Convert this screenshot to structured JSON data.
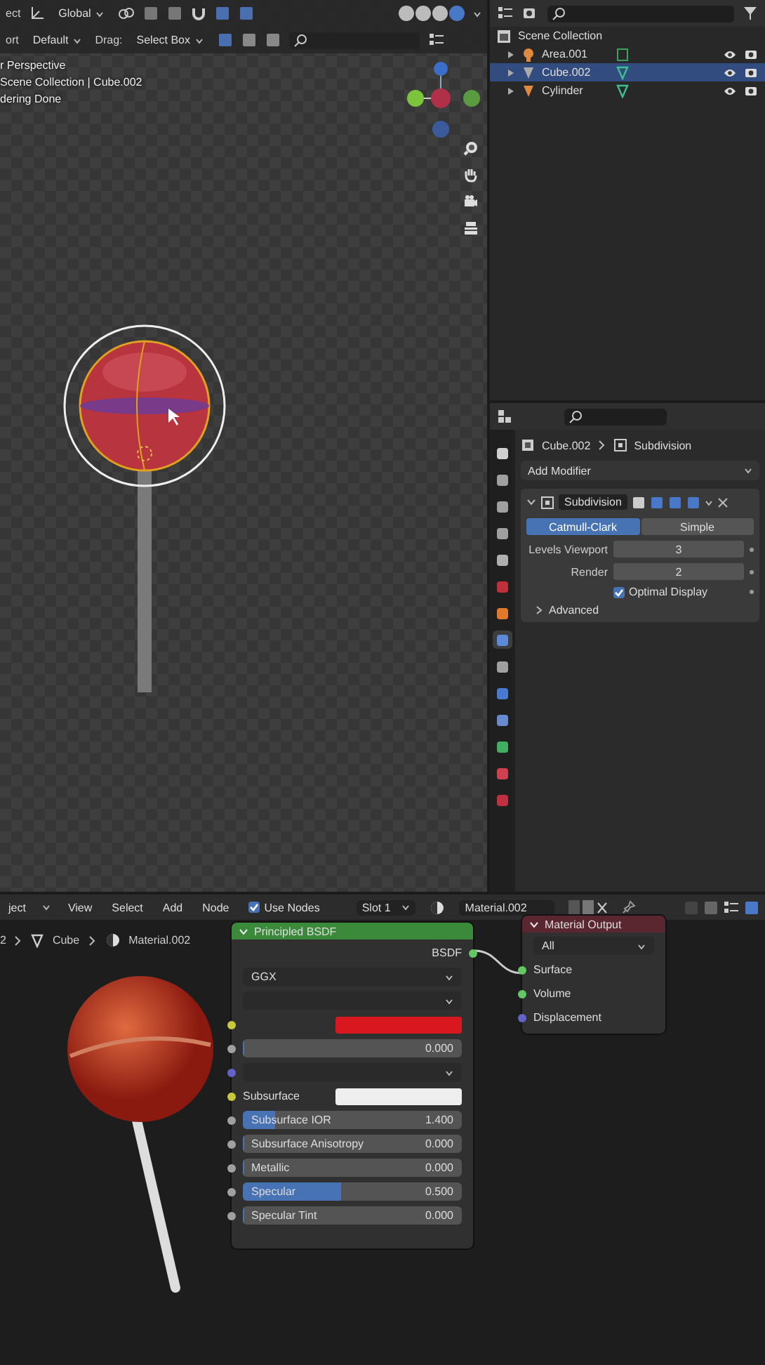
{
  "viewport": {
    "toolbar_top": [
      {
        "kind": "label",
        "label": "ect"
      },
      {
        "kind": "dropdown",
        "label": "Global"
      }
    ],
    "shading_modes": [
      {
        "selected": false
      },
      {
        "selected": false
      },
      {
        "selected": false
      },
      {
        "selected": true
      }
    ],
    "toolbar_bottom": [
      {
        "kind": "label",
        "label": "ort"
      },
      {
        "kind": "dropdown",
        "label": "Default"
      },
      {
        "kind": "label",
        "label": "Drag:"
      },
      {
        "kind": "dropdown",
        "label": "Select Box"
      }
    ],
    "info": [
      "r Perspective",
      "Scene Collection | Cube.002",
      "dering Done"
    ]
  },
  "outliner": {
    "root": "Scene Collection",
    "items": [
      {
        "name": "Area.001",
        "kind": "light",
        "selected": false
      },
      {
        "name": "Cube.002",
        "kind": "mesh",
        "selected": true
      },
      {
        "name": "Cylinder",
        "kind": "mesh",
        "selected": false
      }
    ]
  },
  "properties": {
    "tabs": [
      {
        "color": "#d0d0d0",
        "selected": false
      },
      {
        "color": "#a0a0a0",
        "selected": false
      },
      {
        "color": "#a0a0a0",
        "selected": false
      },
      {
        "color": "#a0a0a0",
        "selected": false
      },
      {
        "color": "#b0b0b0",
        "selected": false
      },
      {
        "color": "#c0303a",
        "selected": false
      },
      {
        "color": "#e07a2a",
        "selected": false
      },
      {
        "color": "#5a8ad8",
        "selected": true
      },
      {
        "color": "#a0a0a0",
        "selected": false
      },
      {
        "color": "#4a7ad0",
        "selected": false
      },
      {
        "color": "#6a8ad0",
        "selected": false
      },
      {
        "color": "#40b060",
        "selected": false
      },
      {
        "color": "#d04050",
        "selected": false
      },
      {
        "color": "#c03040",
        "selected": false
      }
    ],
    "breadcrumb": [
      "Cube.002",
      "Subdivision"
    ],
    "add_modifier": "Add Modifier",
    "modifier": {
      "name": "Subdivision",
      "expanded": true,
      "tabs": [
        {
          "label": "Catmull-Clark",
          "selected": true
        },
        {
          "label": "Simple",
          "selected": false
        }
      ],
      "fields": [
        {
          "label": "Levels Viewport",
          "value": "3"
        },
        {
          "label": "Render",
          "value": "2"
        }
      ],
      "optimal_display": {
        "label": "Optimal Display",
        "checked": true
      },
      "advanced": {
        "label": "Advanced",
        "expanded": false
      }
    }
  },
  "node_editor": {
    "menus": [
      "ject",
      "View",
      "Select",
      "Add",
      "Node"
    ],
    "use_nodes": {
      "label": "Use Nodes",
      "checked": true
    },
    "slot": "Slot 1",
    "material": "Material.002",
    "breadcrumb": [
      "2",
      "Cube",
      "Material.002"
    ],
    "principled": {
      "title": "Principled BSDF",
      "output": "BSDF",
      "rows": [
        {
          "kind": "dropdown",
          "label": "GGX"
        },
        {
          "kind": "dropdown"
        },
        {
          "kind": "color",
          "color": "#d8181e"
        },
        {
          "kind": "value",
          "value": "0.000",
          "level": 0
        },
        {
          "kind": "dropdown",
          "socket": true
        },
        {
          "kind": "color",
          "label": "Subsurface",
          "color": "#eeeeee"
        },
        {
          "kind": "value",
          "label": "Subsurface IOR",
          "value": "1.400",
          "level": 0.15
        },
        {
          "kind": "value",
          "label": "Subsurface Anisotropy",
          "value": "0.000",
          "level": 0
        },
        {
          "kind": "value",
          "label": "Metallic",
          "value": "0.000",
          "level": 0
        },
        {
          "kind": "value",
          "label": "Specular",
          "value": "0.500",
          "level": 0.45
        },
        {
          "kind": "value",
          "label": "Specular Tint",
          "value": "0.000",
          "level": 0
        }
      ]
    },
    "output": {
      "title": "Material Output",
      "target": "All",
      "inputs": [
        {
          "label": "Surface",
          "color": "#63c763"
        },
        {
          "label": "Volume",
          "color": "#63c763"
        },
        {
          "label": "Displacement",
          "color": "#6363c7"
        }
      ]
    }
  }
}
